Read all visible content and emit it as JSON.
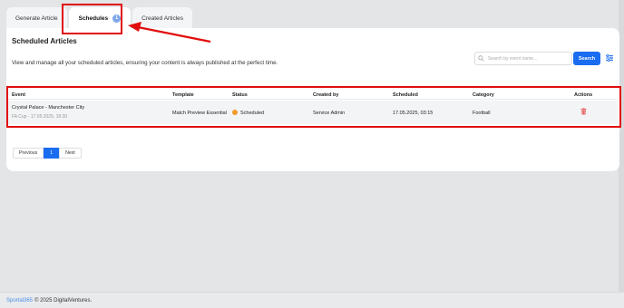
{
  "tabs": [
    {
      "label": "Generate Article"
    },
    {
      "label": "Schedules",
      "count": "1"
    },
    {
      "label": "Created Articles"
    }
  ],
  "page": {
    "title": "Scheduled Articles",
    "description": "View and manage all your scheduled articles, ensuring your content is always published at the perfect time."
  },
  "search": {
    "placeholder": "Search by event name...",
    "button_label": "Search"
  },
  "table": {
    "columns": [
      "Event",
      "Template",
      "Status",
      "Created by",
      "Scheduled",
      "Category",
      "Actions"
    ],
    "rows": [
      {
        "event_title": "Crystal Palace - Manchester City",
        "event_sub": "FA Cup - 17.05.2025, 18:30",
        "template": "Match Preview Essential",
        "status": "Scheduled",
        "created_by": "Service Admin",
        "scheduled": "17.05.2025, 03:15",
        "category": "Football"
      }
    ]
  },
  "pagination": {
    "previous": "Previous",
    "current": "1",
    "next": "Next"
  },
  "footer": {
    "brand": "Sportal365",
    "text": "© 2025 DigitalVentures."
  },
  "colors": {
    "accent": "#1a6cf0",
    "highlight": "#e10e0e",
    "status_scheduled": "#f09a2b"
  }
}
